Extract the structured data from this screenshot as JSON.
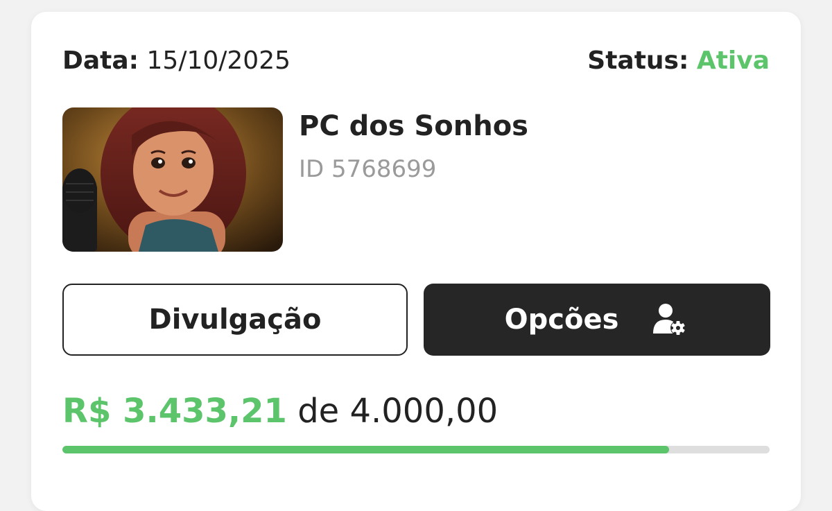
{
  "card": {
    "date_label": "Data:",
    "date_value": "15/10/2025",
    "status_label": "Status:",
    "status_value": "Ativa",
    "title": "PC dos Sonhos",
    "id_text": "ID 5768699",
    "thumbnail_alt": "Illustration of a smiling red-haired woman next to a microphone"
  },
  "buttons": {
    "divulgacao_label": "Divulgação",
    "opcoes_label": "Opcões",
    "opcoes_icon": "user-gear-icon"
  },
  "goal": {
    "raised": "R$ 3.433,21",
    "connector": "de",
    "target": "4.000,00",
    "progress_fraction": 0.8583
  },
  "colors": {
    "accent_green": "#5cc46b",
    "dark_button": "#262626",
    "text": "#222222",
    "muted": "#9a9a9a"
  }
}
